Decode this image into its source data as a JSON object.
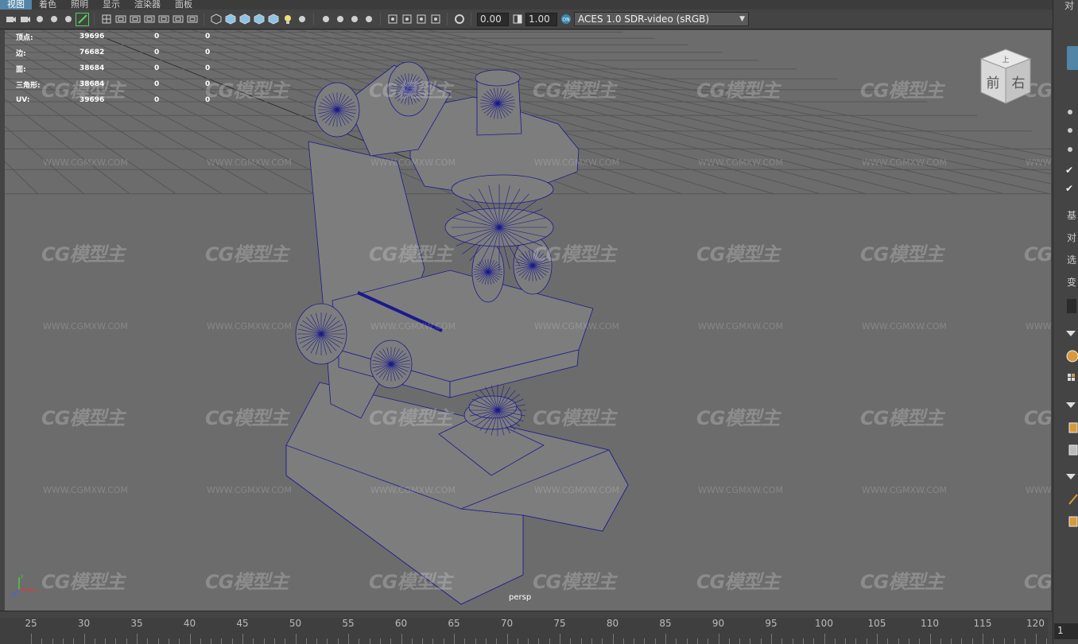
{
  "menu": [
    {
      "label": "视图",
      "active": true
    },
    {
      "label": "着色",
      "active": false
    },
    {
      "label": "照明",
      "active": false
    },
    {
      "label": "显示",
      "active": false
    },
    {
      "label": "渲染器",
      "active": false
    },
    {
      "label": "面板",
      "active": false
    }
  ],
  "toolbar": {
    "exposure_value": "0.00",
    "gamma_value": "1.00",
    "colorspace": "ACES 1.0 SDR-video (sRGB)",
    "groups": [
      [
        "camera-icon",
        "camera-attributes-icon",
        "bookmark-icon",
        "image-plane-icon",
        "2d-pan-icon",
        "grease-pencil-icon"
      ],
      [
        "grid-icon",
        "film-gate-icon",
        "resolution-gate-icon",
        "gate-mask-icon",
        "field-chart-icon",
        "safe-action-icon",
        "safe-title-icon"
      ],
      [
        "wireframe-icon",
        "smooth-shade-icon",
        "flat-shade-icon",
        "wireframe-on-shaded-icon",
        "textured-icon",
        "use-lights-icon",
        "shadows-icon"
      ],
      [
        "ambient-occlusion-icon",
        "motion-blur-icon",
        "antialiasing-icon",
        "depth-of-field-icon"
      ],
      [
        "isolate-select-icon",
        "xray-icon",
        "xray-joints-icon",
        "xray-active-icon"
      ],
      [
        "exposure-icon"
      ]
    ]
  },
  "hud": {
    "rows": [
      {
        "label": "顶点:",
        "value": "39696",
        "a": "0",
        "b": "0"
      },
      {
        "label": "边:",
        "value": "76682",
        "a": "0",
        "b": "0"
      },
      {
        "label": "面:",
        "value": "38684",
        "a": "0",
        "b": "0"
      },
      {
        "label": "三角形:",
        "value": "38684",
        "a": "0",
        "b": "0"
      },
      {
        "label": "UV:",
        "value": "39696",
        "a": "0",
        "b": "0"
      }
    ]
  },
  "viewcube": {
    "top": "上",
    "front": "前",
    "right": "右"
  },
  "camera_label": "persp",
  "watermark": {
    "logo": "CG模型主",
    "url": "WWW.CGMXW.COM"
  },
  "right_panel": {
    "title": "对",
    "labels": [
      "基",
      "对",
      "选",
      "变"
    ]
  },
  "timeline": {
    "ticks": [
      "25",
      "30",
      "35",
      "40",
      "45",
      "50",
      "55",
      "60",
      "65",
      "70",
      "75",
      "80",
      "85",
      "90",
      "95",
      "100",
      "105",
      "110",
      "115",
      "120"
    ],
    "current_frame": "1"
  },
  "colors": {
    "accent": "#5285a6",
    "wire": "#1a1a8c",
    "viewport": "#6c6c6c",
    "highlight": "#5ad05a"
  }
}
